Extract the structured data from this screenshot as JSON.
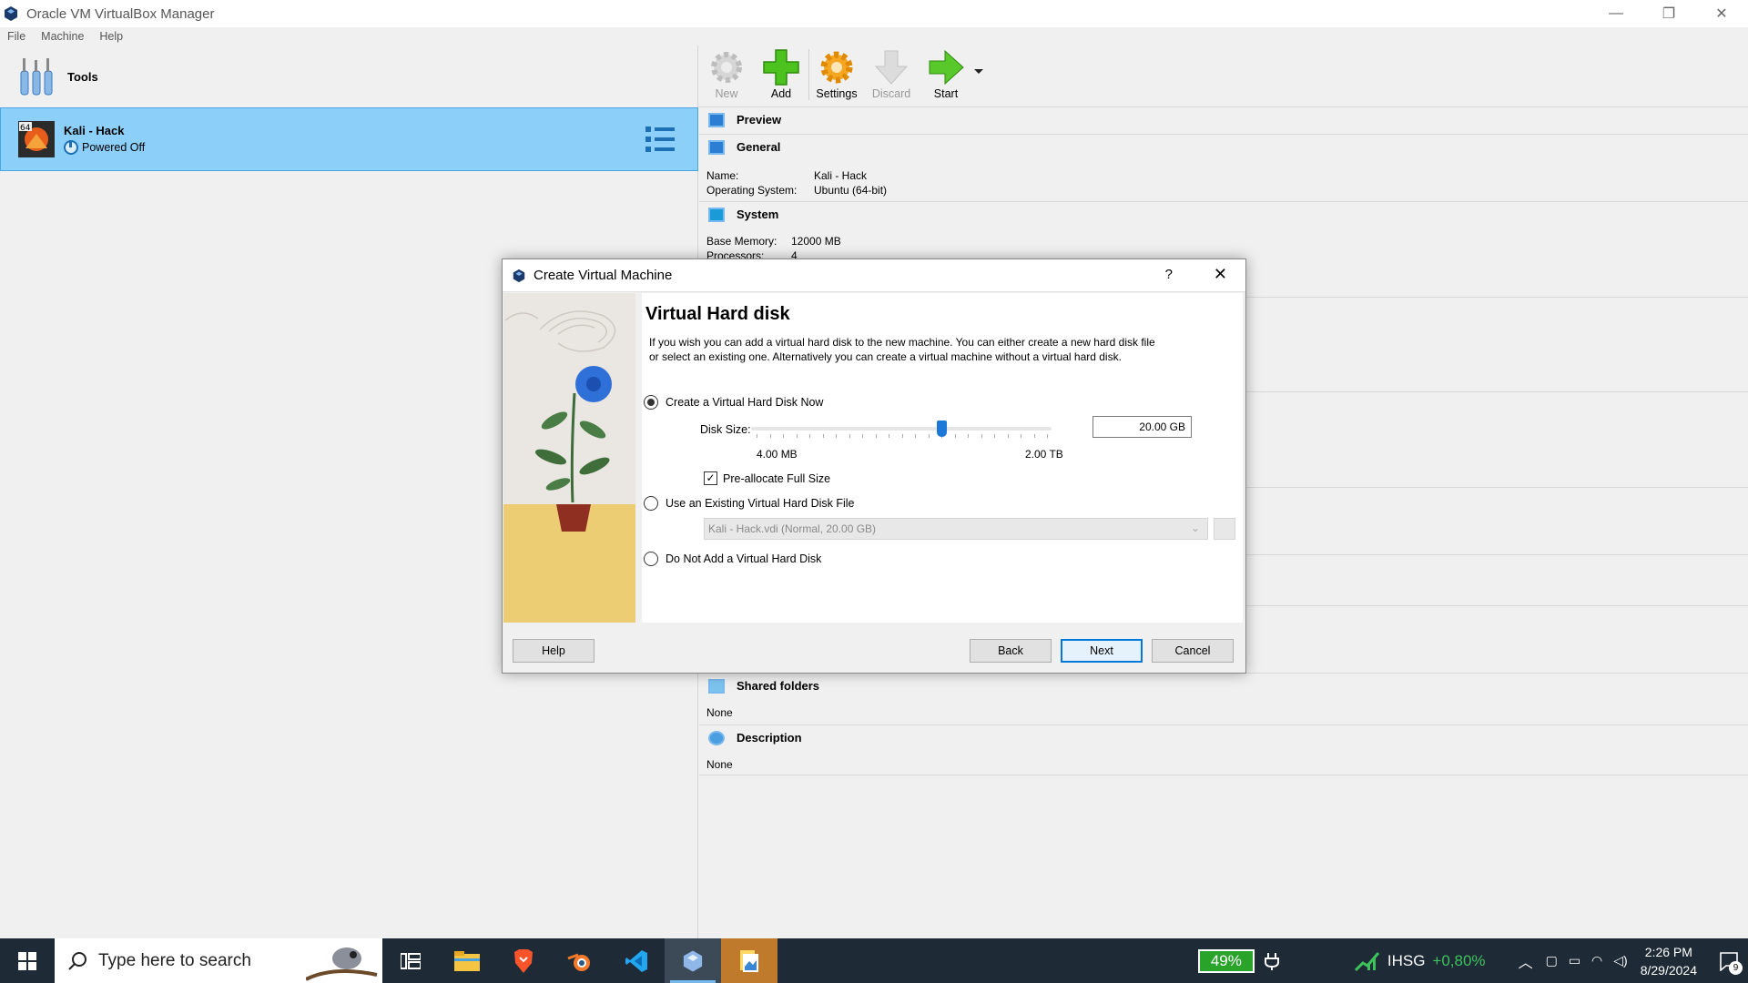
{
  "window": {
    "title": "Oracle VM VirtualBox Manager",
    "controls": [
      "—",
      "❐",
      "✕"
    ]
  },
  "menu": [
    "File",
    "Machine",
    "Help"
  ],
  "tools": {
    "label": "Tools"
  },
  "vm": {
    "name": "Kali - Hack",
    "state": "Powered Off",
    "badge": "64"
  },
  "toolbar": {
    "new": "New",
    "add": "Add",
    "settings": "Settings",
    "discard": "Discard",
    "start": "Start"
  },
  "details": {
    "preview": "Preview",
    "general": "General",
    "name_k": "Name:",
    "name_v": "Kali - Hack",
    "os_k": "Operating System:",
    "os_v": "Ubuntu (64-bit)",
    "system": "System",
    "mem_k": "Base Memory:",
    "mem_v": "12000 MB",
    "proc_k": "Processors:",
    "proc_v": "4",
    "shared": "Shared folders",
    "shared_v": "None",
    "description": "Description",
    "description_v": "None"
  },
  "dialog": {
    "title": "Create Virtual Machine",
    "help_glyph": "?",
    "heading": "Virtual Hard disk",
    "intro": "If you wish you can add a virtual hard disk to the new machine. You can either create a new hard disk file or select an existing one. Alternatively you can create a virtual machine without a virtual hard disk.",
    "opt_create": "Create a Virtual Hard Disk Now",
    "disk_size_label": "Disk Size:",
    "disk_size_value": "20.00 GB",
    "slider_fraction": 0.64,
    "min_label": "4.00 MB",
    "max_label": "2.00 TB",
    "prealloc": "Pre-allocate Full Size",
    "opt_existing": "Use an Existing Virtual Hard Disk File",
    "existing_file": "Kali - Hack.vdi (Normal, 20.00 GB)",
    "opt_none": "Do Not Add a Virtual Hard Disk",
    "btn_help": "Help",
    "btn_back": "Back",
    "btn_next": "Next",
    "btn_cancel": "Cancel"
  },
  "taskbar": {
    "search_placeholder": "Type here to search",
    "battery": "49%",
    "ticker": "IHSG",
    "ticker_change": "+0,80%",
    "time": "2:26 PM",
    "date": "8/29/2024",
    "notifications": "9"
  },
  "colors": {
    "selection": "#8ccff8",
    "accent": "#0078d7",
    "taskbar": "#1e2a36",
    "ticker_up": "#3cc35c"
  }
}
